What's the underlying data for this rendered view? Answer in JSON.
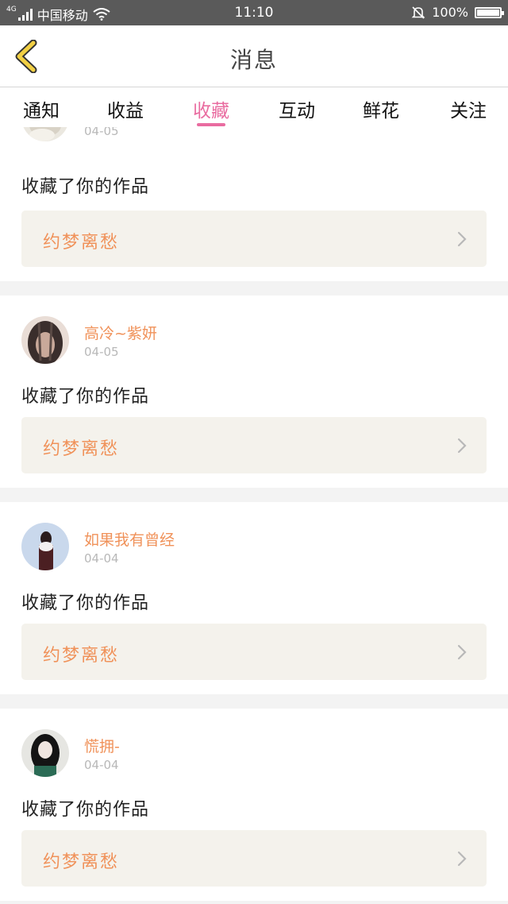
{
  "status_bar": {
    "network": "4G",
    "carrier": "中国移动",
    "time": "11:10",
    "battery": "100%",
    "battery_level": 1.0
  },
  "nav": {
    "title": "消息"
  },
  "tabs": [
    {
      "label": "通知"
    },
    {
      "label": "收益"
    },
    {
      "label": "收藏"
    },
    {
      "label": "互动"
    },
    {
      "label": "鲜花"
    },
    {
      "label": "关注"
    }
  ],
  "active_tab": "收藏",
  "colors": {
    "accent_pink": "#e96ca0",
    "name_orange": "#f0925a",
    "back_yellow": "#f2d044"
  },
  "items": [
    {
      "name": "",
      "date": "04-05",
      "action": "收藏了你的作品",
      "work": "约梦离愁"
    },
    {
      "name": "高冷~紫妍",
      "date": "04-05",
      "action": "收藏了你的作品",
      "work": "约梦离愁"
    },
    {
      "name": "如果我有曾经",
      "date": "04-04",
      "action": "收藏了你的作品",
      "work": "约梦离愁"
    },
    {
      "name": "慌拥-",
      "date": "04-04",
      "action": "收藏了你的作品",
      "work": "约梦离愁"
    }
  ]
}
